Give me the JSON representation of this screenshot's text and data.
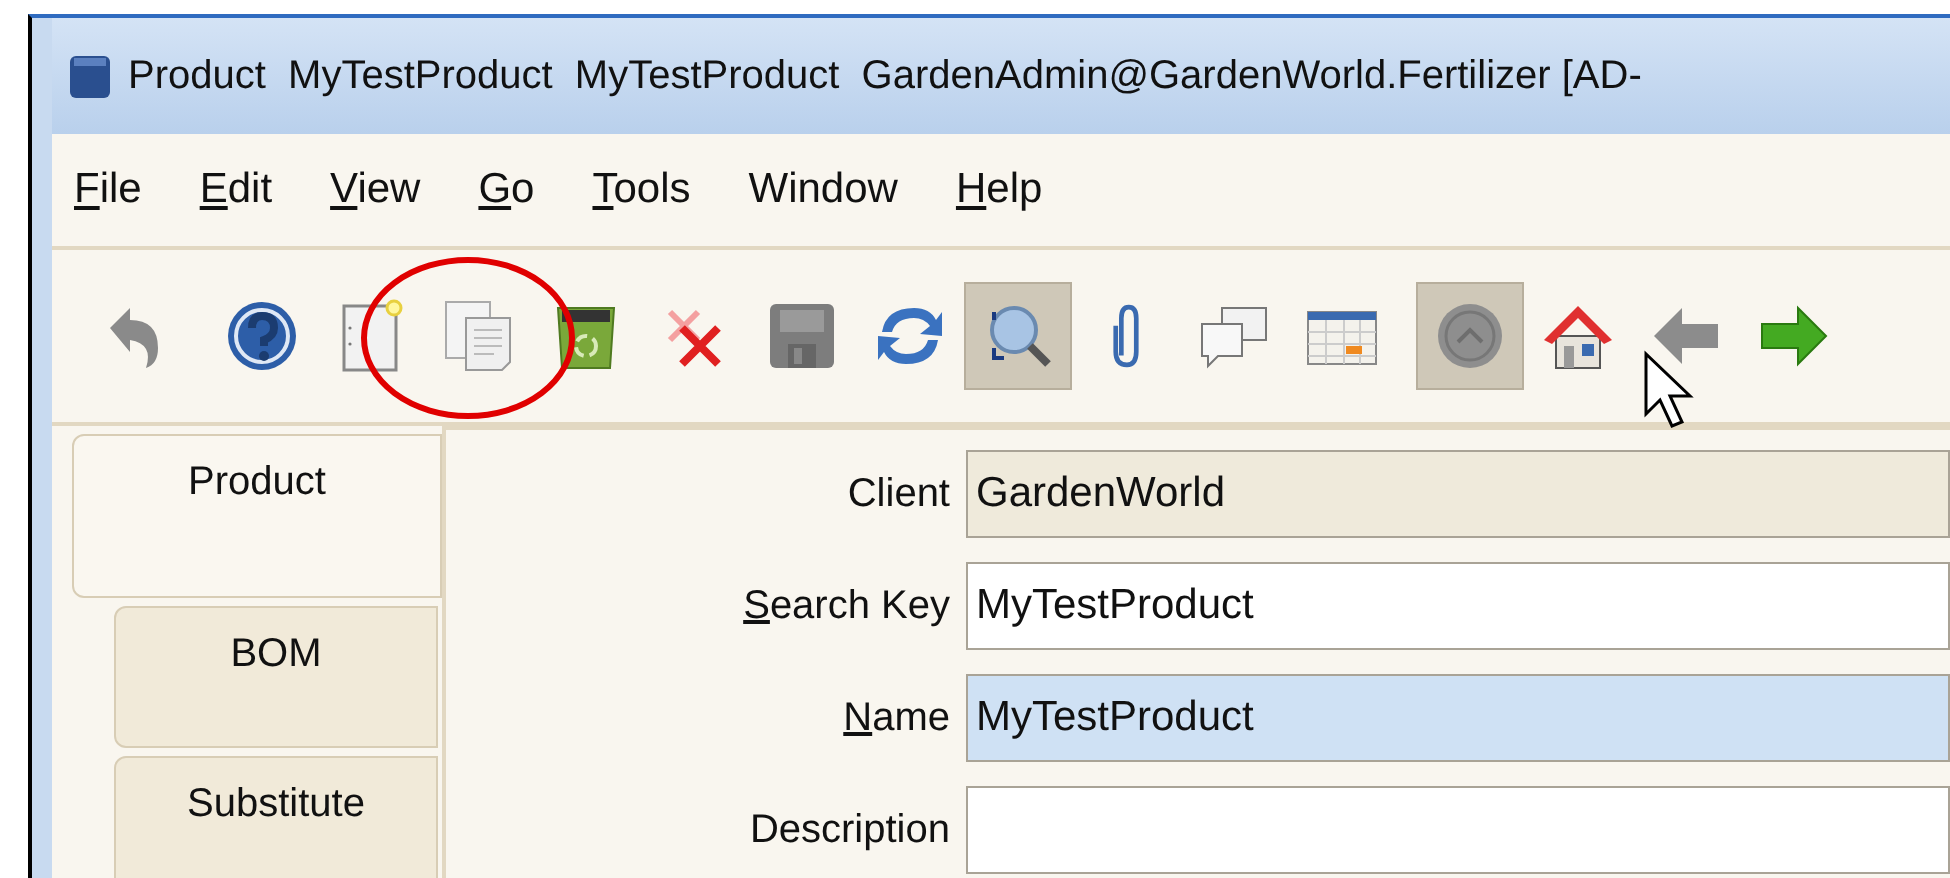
{
  "window": {
    "title": "Product  MyTestProduct  MyTestProduct  GardenAdmin@GardenWorld.Fertilizer [AD-"
  },
  "menu": [
    {
      "label": "File",
      "mnemonic": true
    },
    {
      "label": "Edit",
      "mnemonic": true
    },
    {
      "label": "View",
      "mnemonic": true
    },
    {
      "label": "Go",
      "mnemonic": true
    },
    {
      "label": "Tools",
      "mnemonic": true
    },
    {
      "label": "Window",
      "mnemonic": false
    },
    {
      "label": "Help",
      "mnemonic": true
    }
  ],
  "toolbar": [
    {
      "kind": "undo",
      "pressed": false
    },
    {
      "kind": "help",
      "pressed": false
    },
    {
      "kind": "new",
      "pressed": false
    },
    {
      "kind": "copy",
      "pressed": false
    },
    {
      "kind": "delete",
      "pressed": false
    },
    {
      "kind": "delete-selection",
      "pressed": false
    },
    {
      "kind": "save",
      "pressed": false
    },
    {
      "kind": "refresh",
      "pressed": false
    },
    {
      "kind": "find",
      "pressed": true
    },
    {
      "kind": "attachment",
      "pressed": false
    },
    {
      "kind": "chat",
      "pressed": false
    },
    {
      "kind": "grid",
      "pressed": false
    },
    {
      "kind": "history",
      "pressed": true
    },
    {
      "kind": "home",
      "pressed": false
    },
    {
      "kind": "back",
      "pressed": false
    },
    {
      "kind": "forward",
      "pressed": false
    }
  ],
  "tabs": [
    {
      "label": "Product",
      "selected": true
    },
    {
      "label": "BOM",
      "selected": false
    },
    {
      "label": "Substitute",
      "selected": false
    }
  ],
  "fields": [
    {
      "label": "Client",
      "mnemonic": false,
      "value": "GardenWorld",
      "kind": "readonly"
    },
    {
      "label": "Search Key",
      "mnemonic": true,
      "value": "MyTestProduct",
      "kind": "normal"
    },
    {
      "label": "Name",
      "mnemonic": true,
      "value": "MyTestProduct",
      "kind": "focused"
    },
    {
      "label": "Description",
      "mnemonic": false,
      "kind": "normal"
    }
  ]
}
